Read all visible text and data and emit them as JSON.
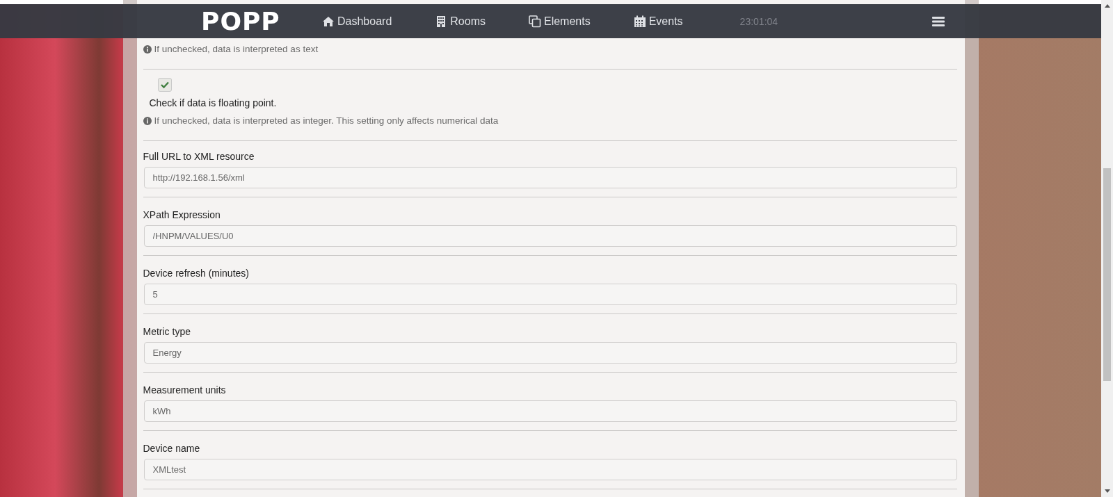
{
  "navbar": {
    "logo": "POPP",
    "items": [
      {
        "label": "Dashboard",
        "kind": "house"
      },
      {
        "label": "Rooms",
        "kind": "building"
      },
      {
        "label": "Elements",
        "kind": "squares"
      },
      {
        "label": "Events",
        "kind": "calendar"
      }
    ],
    "time": "23:01:04"
  },
  "form": {
    "rows": [
      {
        "kind": "hint",
        "text": "If unchecked, data is interpreted as text"
      },
      {
        "kind": "checkbox",
        "label": "Check if data is floating point.",
        "checked": true,
        "hint": "If unchecked, data is interpreted as integer. This setting only affects numerical data"
      },
      {
        "kind": "field",
        "label": "Full URL to XML resource",
        "value": "http://192.168.1.56/xml"
      },
      {
        "kind": "field",
        "label": "XPath Expression",
        "value": "/HNPM/VALUES/U0"
      },
      {
        "kind": "field",
        "label": "Device refresh (minutes)",
        "value": "5"
      },
      {
        "kind": "field",
        "label": "Metric type",
        "value": "Energy"
      },
      {
        "kind": "field",
        "label": "Measurement units",
        "value": "kWh"
      },
      {
        "kind": "field",
        "label": "Device name",
        "value": "XMLtest"
      }
    ]
  }
}
